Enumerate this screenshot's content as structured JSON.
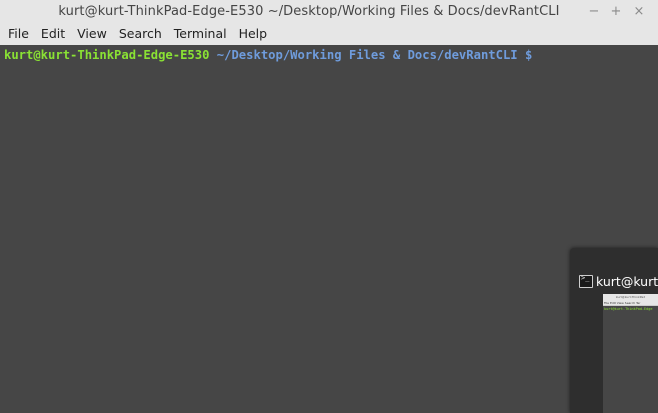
{
  "window": {
    "title": "kurt@kurt-ThinkPad-Edge-E530 ~/Desktop/Working Files & Docs/devRantCLI",
    "controls": {
      "minimize": "−",
      "maximize": "+",
      "close": "×"
    }
  },
  "menubar": {
    "items": [
      "File",
      "Edit",
      "View",
      "Search",
      "Terminal",
      "Help"
    ]
  },
  "terminal": {
    "user_host": "kurt@kurt-ThinkPad-Edge-E530",
    "path": " ~/Desktop/Working Files & Docs/devRantCLI $",
    "colors": {
      "user": "#8ae234",
      "path": "#6f9cdc",
      "background": "#464646"
    }
  },
  "preview": {
    "title": "kurt@kurt-T",
    "thumb_title": "kurt@kurt-ThinkPad",
    "thumb_menu": "File Edit View Search Ter",
    "thumb_prompt": "kurt@kurt-ThinkPad-Edge"
  }
}
